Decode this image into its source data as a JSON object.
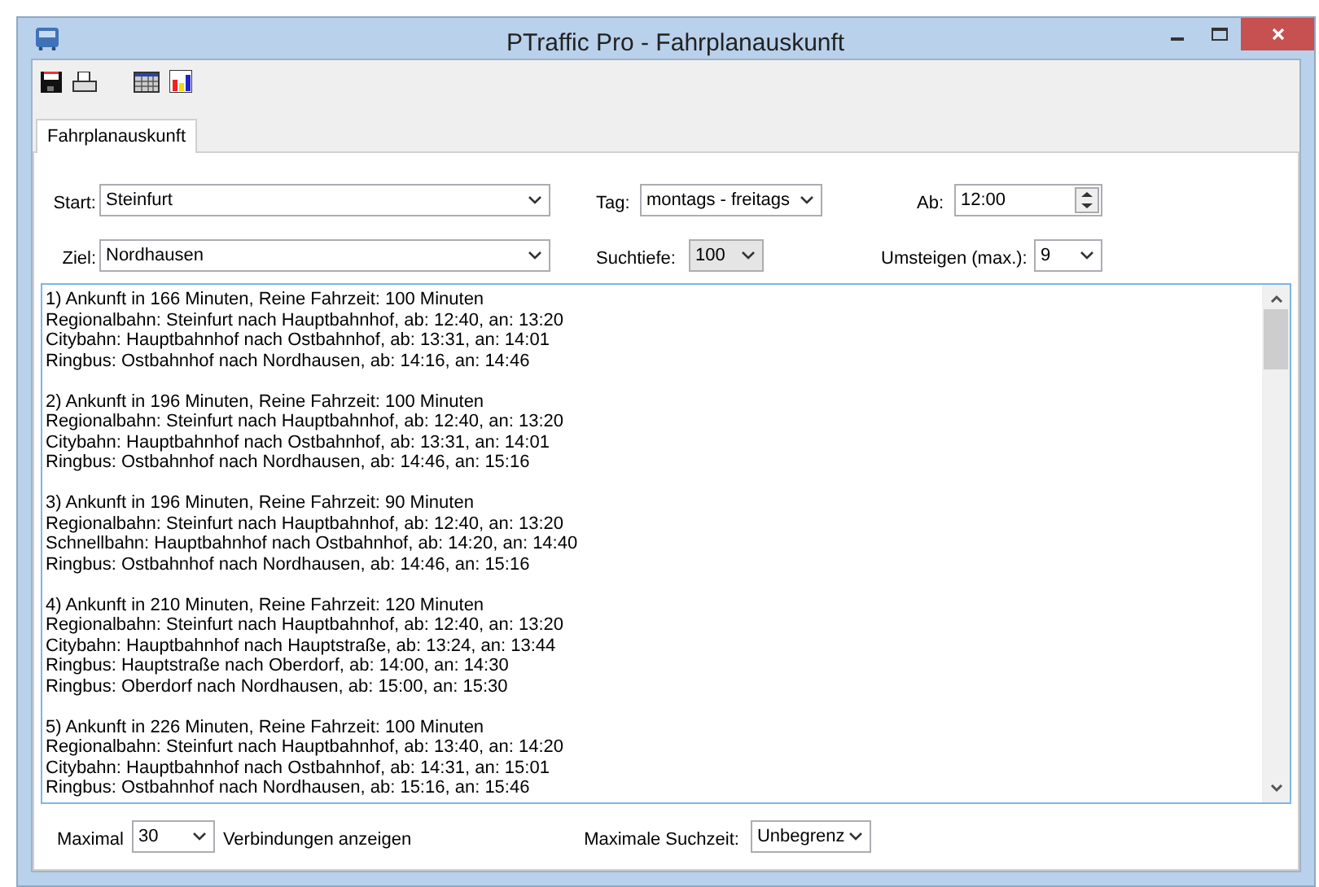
{
  "window": {
    "title": "PTraffic Pro - Fahrplanauskunft"
  },
  "tabs": [
    {
      "label": "Fahrplanauskunft",
      "selected": true
    }
  ],
  "form": {
    "start": {
      "label": "Start:",
      "value": "Steinfurt"
    },
    "tag": {
      "label": "Tag:",
      "value": "montags - freitags"
    },
    "ab": {
      "label": "Ab:",
      "value": "12:00"
    },
    "ziel": {
      "label": "Ziel:",
      "value": "Nordhausen"
    },
    "suchtiefe": {
      "label": "Suchtiefe:",
      "value": "100"
    },
    "umsteigen": {
      "label": "Umsteigen (max.):",
      "value": "9"
    }
  },
  "results": [
    {
      "header": "1) Ankunft in 166 Minuten, Reine Fahrzeit: 100 Minuten",
      "legs": [
        "Regionalbahn: Steinfurt nach Hauptbahnhof, ab: 12:40, an: 13:20",
        "Citybahn: Hauptbahnhof nach Ostbahnhof, ab: 13:31, an: 14:01",
        "Ringbus: Ostbahnhof nach Nordhausen, ab: 14:16, an: 14:46"
      ]
    },
    {
      "header": "2) Ankunft in 196 Minuten, Reine Fahrzeit: 100 Minuten",
      "legs": [
        "Regionalbahn: Steinfurt nach Hauptbahnhof, ab: 12:40, an: 13:20",
        "Citybahn: Hauptbahnhof nach Ostbahnhof, ab: 13:31, an: 14:01",
        "Ringbus: Ostbahnhof nach Nordhausen, ab: 14:46, an: 15:16"
      ]
    },
    {
      "header": "3) Ankunft in 196 Minuten, Reine Fahrzeit: 90 Minuten",
      "legs": [
        "Regionalbahn: Steinfurt nach Hauptbahnhof, ab: 12:40, an: 13:20",
        "Schnellbahn: Hauptbahnhof nach Ostbahnhof, ab: 14:20, an: 14:40",
        "Ringbus: Ostbahnhof nach Nordhausen, ab: 14:46, an: 15:16"
      ]
    },
    {
      "header": "4) Ankunft in 210 Minuten, Reine Fahrzeit: 120 Minuten",
      "legs": [
        "Regionalbahn: Steinfurt nach Hauptbahnhof, ab: 12:40, an: 13:20",
        "Citybahn: Hauptbahnhof nach Hauptstraße, ab: 13:24, an: 13:44",
        "Ringbus: Hauptstraße nach Oberdorf, ab: 14:00, an: 14:30",
        "Ringbus: Oberdorf nach Nordhausen, ab: 15:00, an: 15:30"
      ]
    },
    {
      "header": "5) Ankunft in 226 Minuten, Reine Fahrzeit: 100 Minuten",
      "legs": [
        "Regionalbahn: Steinfurt nach Hauptbahnhof, ab: 13:40, an: 14:20",
        "Citybahn: Hauptbahnhof nach Ostbahnhof, ab: 14:31, an: 15:01",
        "Ringbus: Ostbahnhof nach Nordhausen, ab: 15:16, an: 15:46"
      ]
    }
  ],
  "footer": {
    "maximal_label": "Maximal",
    "maximal_value": "30",
    "connections_label": "Verbindungen anzeigen",
    "suchzeit_label": "Maximale Suchzeit:",
    "suchzeit_value": "Unbegrenz"
  }
}
